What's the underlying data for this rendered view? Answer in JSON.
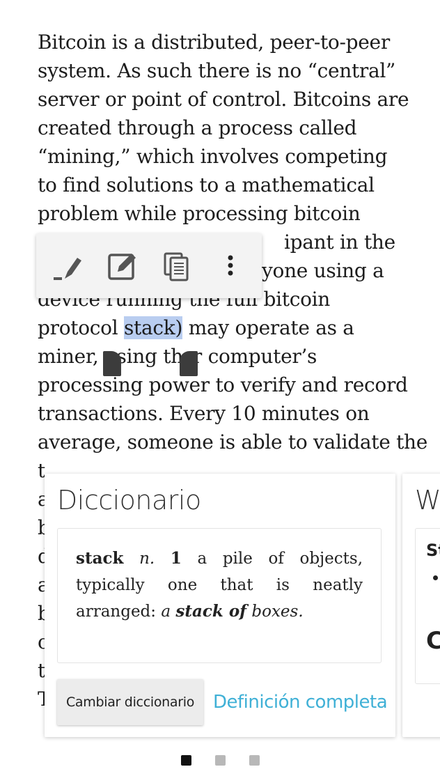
{
  "reader": {
    "lines": [
      "Bitcoin is a distributed, peer-to-peer",
      "system. As such there is no “central”",
      "server or point of control. Bitcoins are",
      "created through a process called",
      "“mining,” which involves competing",
      "to find solutions to a mathematical",
      "problem while processing bitcoin",
      "ipant in the",
      "yone using a",
      "device running the full bitcoin",
      "may operate as a",
      "miner,",
      "sing th",
      "r computer’s",
      "processing power to verify and record",
      "transactions. Every 10 minutes on",
      "average, someone is able to validate the",
      "t",
      "a",
      "b",
      "d",
      "a",
      "b",
      "c",
      "t",
      "T"
    ],
    "protocol_prefix": "protocol ",
    "selected_word": "stack)"
  },
  "toolbar": {
    "highlight_icon": "highlight-icon",
    "note_icon": "edit-note-icon",
    "copy_icon": "copy-icon",
    "more_icon": "more-vert-icon"
  },
  "dictionary": {
    "title": "Diccionario",
    "headword": "stack",
    "pos": "n.",
    "sense_number": "1",
    "definition": "a pile of objects, typically one that is neatly arranged:",
    "example_a": "a",
    "example_bold": "stack of",
    "example_rest": "boxes.",
    "change_button": "Cambiar diccionario",
    "full_definition_link": "Definición completa",
    "link_color": "#3fb0d6"
  },
  "next_card": {
    "title": "W",
    "t1": "St",
    "t2": "C"
  },
  "pager": {
    "count": 3,
    "active_index": 0
  }
}
